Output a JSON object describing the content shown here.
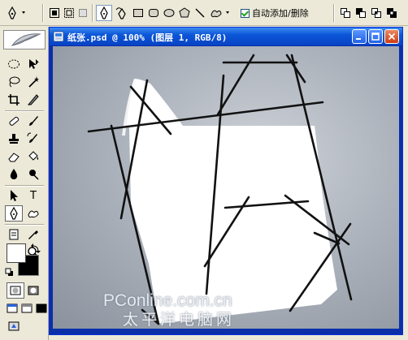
{
  "options_bar": {
    "auto_add_delete_label": "自动添加/删除",
    "auto_add_delete_checked": true
  },
  "icons": {
    "tools": [
      "pen-icon",
      "freeform-pen-icon",
      "rectangle-icon",
      "rounded-rectangle-icon",
      "ellipse-icon",
      "polygon-icon",
      "line-icon",
      "custom-shape-icon"
    ],
    "path_modes": [
      "shape-layers-icon",
      "paths-icon",
      "fill-pixels-icon"
    ],
    "path_ops": [
      "add-area-icon",
      "subtract-area-icon",
      "intersect-area-icon",
      "exclude-area-icon"
    ]
  },
  "document": {
    "title": "纸张.psd @ 100% (图层 1, RGB/8)"
  },
  "colors": {
    "foreground": "#ffffff",
    "background": "#000000",
    "title_bar": "#0b56d8",
    "paper": "#ffffff",
    "canvas_grey": "#aeb4bd"
  },
  "watermark": {
    "line1": "PConline.com.cn",
    "line2": "太平洋电脑网"
  }
}
